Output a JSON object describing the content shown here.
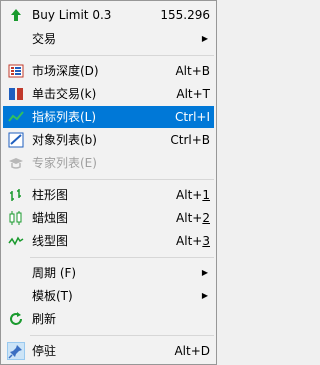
{
  "menu": {
    "buy_limit": {
      "label": "Buy Limit 0.3",
      "value": "155.296",
      "icon": "buy-limit-arrow-icon"
    },
    "trade": {
      "label": "交易",
      "submenu": true
    },
    "market_depth": {
      "label": "市场深度(D)",
      "shortcut": "Alt+B",
      "icon": "market-depth-icon"
    },
    "one_click": {
      "label": "单击交易(k)",
      "shortcut": "Alt+T",
      "icon": "one-click-trading-icon"
    },
    "indicators_list": {
      "label": "指标列表(L)",
      "shortcut": "Ctrl+I",
      "icon": "indicators-list-icon"
    },
    "objects_list": {
      "label": "对象列表(b)",
      "shortcut": "Ctrl+B",
      "icon": "objects-list-icon"
    },
    "experts_list": {
      "label": "专家列表(E)",
      "icon": "experts-list-icon"
    },
    "bar_chart": {
      "label": "柱形图",
      "shortcut_prefix": "Alt+",
      "shortcut_key": "1",
      "icon": "bar-chart-icon"
    },
    "candlesticks": {
      "label": "蜡烛图",
      "shortcut_prefix": "Alt+",
      "shortcut_key": "2",
      "icon": "candlestick-chart-icon"
    },
    "line_chart": {
      "label": "线型图",
      "shortcut_prefix": "Alt+",
      "shortcut_key": "3",
      "icon": "line-chart-icon"
    },
    "period": {
      "label": "周期 (F)",
      "submenu": true
    },
    "template": {
      "label": "模板(T)",
      "submenu": true
    },
    "refresh": {
      "label": "刷新",
      "icon": "refresh-icon"
    },
    "dock": {
      "label": "停驻",
      "shortcut": "Alt+D",
      "icon": "pin-icon"
    }
  },
  "colors": {
    "highlight": "#0078d7",
    "green": "#1a9a2e",
    "red": "#c0392b",
    "blue": "#1f5fbf"
  }
}
